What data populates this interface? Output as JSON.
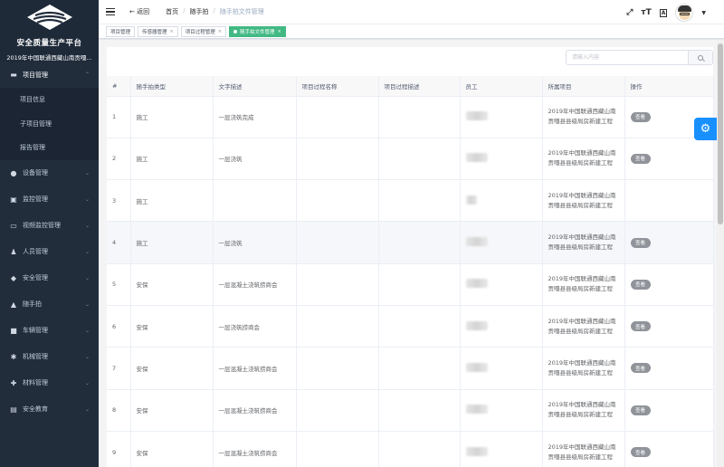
{
  "sidebar": {
    "platform_title": "安全质量生产平台",
    "project_name": "2019年中国联通西藏山南贡嘎...",
    "menu": [
      {
        "label": "项目管理",
        "icon": "folder-icon",
        "expanded": true,
        "children": [
          "项目信息",
          "子项目管理",
          "报告管理"
        ]
      },
      {
        "label": "设备管理",
        "icon": "user-icon"
      },
      {
        "label": "监控管理",
        "icon": "monitor-icon"
      },
      {
        "label": "视频监控管理",
        "icon": "video-icon"
      },
      {
        "label": "人员管理",
        "icon": "person-icon"
      },
      {
        "label": "安全管理",
        "icon": "shield-icon"
      },
      {
        "label": "随手拍",
        "icon": "camera-icon"
      },
      {
        "label": "车辆管理",
        "icon": "car-icon"
      },
      {
        "label": "机械管理",
        "icon": "machine-icon"
      },
      {
        "label": "材料管理",
        "icon": "material-icon"
      },
      {
        "label": "安全教育",
        "icon": "education-icon"
      }
    ]
  },
  "header": {
    "back_label": "返回",
    "breadcrumb": [
      "首页",
      "随手拍",
      "随手拍文件管理"
    ],
    "icons": [
      "fullscreen-icon",
      "font-size-icon",
      "translate-icon"
    ]
  },
  "tags": [
    {
      "label": "项目管理",
      "closable": false,
      "active": false
    },
    {
      "label": "传感器管理",
      "closable": true,
      "active": false
    },
    {
      "label": "项目过程管理",
      "closable": true,
      "active": false
    },
    {
      "label": "随手拍文件管理",
      "closable": true,
      "active": true
    }
  ],
  "search": {
    "placeholder": "请输入内容"
  },
  "table": {
    "columns": [
      "#",
      "随手拍类型",
      "文字描述",
      "项目过程名称",
      "项目过程描述",
      "员工",
      "所属项目",
      "操作"
    ],
    "view_label": "查看",
    "project_label": "2019年中国联通西藏山南贡嘎县县级局房新建工程",
    "rows": [
      {
        "no": "1",
        "type": "施工",
        "desc": "一层浇筑完成",
        "has_view": true
      },
      {
        "no": "2",
        "type": "施工",
        "desc": "一层浇筑",
        "has_view": true
      },
      {
        "no": "3",
        "type": "施工",
        "desc": "",
        "has_view": false
      },
      {
        "no": "4",
        "type": "施工",
        "desc": "一层浇筑",
        "has_view": true
      },
      {
        "no": "5",
        "type": "安保",
        "desc": "一层混凝土浇筑捞商会",
        "has_view": true
      },
      {
        "no": "6",
        "type": "安保",
        "desc": "一层浇筑捞商会",
        "has_view": true
      },
      {
        "no": "7",
        "type": "安保",
        "desc": "一层混凝土浇筑捞商会",
        "has_view": true
      },
      {
        "no": "8",
        "type": "安保",
        "desc": "一层混凝土浇筑捞商会",
        "has_view": true
      },
      {
        "no": "9",
        "type": "安保",
        "desc": "一层混凝土浇筑捞商会",
        "has_view": true
      }
    ]
  },
  "colors": {
    "sidebar_bg": "#222d3c",
    "active_tag": "#42b983",
    "fab": "#1890ff"
  }
}
